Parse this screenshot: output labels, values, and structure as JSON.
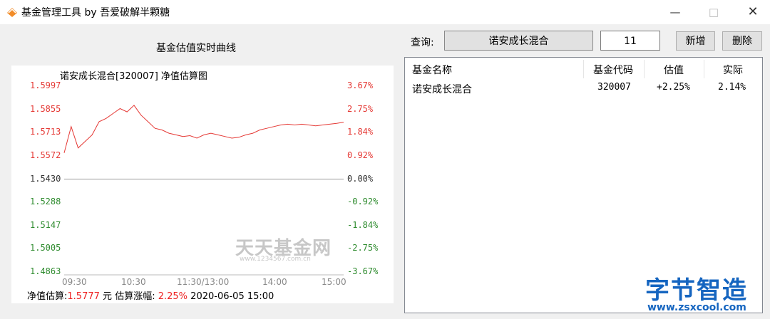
{
  "window": {
    "title": "基金管理工具 by 吾爱破解半颗糖"
  },
  "chart": {
    "heading": "基金估值实时曲线",
    "title": "诺安成长混合[320007] 净值估算图",
    "watermark": "天天基金网",
    "watermark_url": "www.1234567.com.cn",
    "y_left": [
      "1.5997",
      "1.5855",
      "1.5713",
      "1.5572",
      "1.5430",
      "1.5288",
      "1.5147",
      "1.5005",
      "1.4863"
    ],
    "y_right": [
      "3.67%",
      "2.75%",
      "1.84%",
      "0.92%",
      "0.00%",
      "-0.92%",
      "-1.84%",
      "-2.75%",
      "-3.67%"
    ],
    "x_labels": [
      "09:30",
      "10:30",
      "11:30/13:00",
      "14:00",
      "15:00"
    ],
    "footer": {
      "nav_label": "净值估算:",
      "nav_value": "1.5777",
      "unit": "元",
      "change_label": "估算涨幅:",
      "change_value": "2.25%",
      "datetime": "2020-06-05 15:00"
    }
  },
  "chart_data": {
    "type": "line",
    "title": "诺安成长混合[320007] 净值估算图",
    "xlabel": "",
    "ylabel": "",
    "x_ticks": [
      "09:30",
      "10:30",
      "11:30/13:00",
      "14:00",
      "15:00"
    ],
    "ylim": [
      1.4863,
      1.5997
    ],
    "baseline": 1.543,
    "x": [
      0,
      6,
      12,
      18,
      24,
      30,
      36,
      42,
      48,
      54,
      60,
      66,
      72,
      78,
      84,
      90,
      96,
      102,
      108,
      114,
      120,
      126,
      132,
      138,
      144,
      150,
      156,
      162,
      168,
      174,
      180,
      186,
      192,
      198,
      204,
      210,
      216,
      222,
      228,
      234,
      240
    ],
    "y": [
      1.559,
      1.575,
      1.562,
      1.566,
      1.57,
      1.578,
      1.58,
      1.583,
      1.586,
      1.584,
      1.588,
      1.582,
      1.578,
      1.574,
      1.573,
      1.571,
      1.57,
      1.569,
      1.5695,
      1.568,
      1.57,
      1.571,
      1.57,
      1.569,
      1.568,
      1.5685,
      1.57,
      1.571,
      1.573,
      1.574,
      1.575,
      1.576,
      1.5765,
      1.576,
      1.5765,
      1.576,
      1.5755,
      1.576,
      1.5765,
      1.577,
      1.5777
    ],
    "line_color": "#e53935",
    "colors": {
      "up": "#e53935",
      "down": "#2e8b2e",
      "neutral": "#333333"
    }
  },
  "query": {
    "label": "查询:",
    "selected_fund": "诺安成长混合",
    "code_value": "11"
  },
  "buttons": {
    "add": "新增",
    "delete": "删除"
  },
  "list": {
    "columns": [
      "基金名称",
      "基金代码",
      "估值",
      "实际"
    ],
    "rows": [
      {
        "name": "诺安成长混合",
        "code": "320007",
        "estimate": "+2.25%",
        "actual": "2.14%"
      }
    ]
  },
  "branding": {
    "text": "字节智造",
    "url": "www.zsxcool.com"
  }
}
